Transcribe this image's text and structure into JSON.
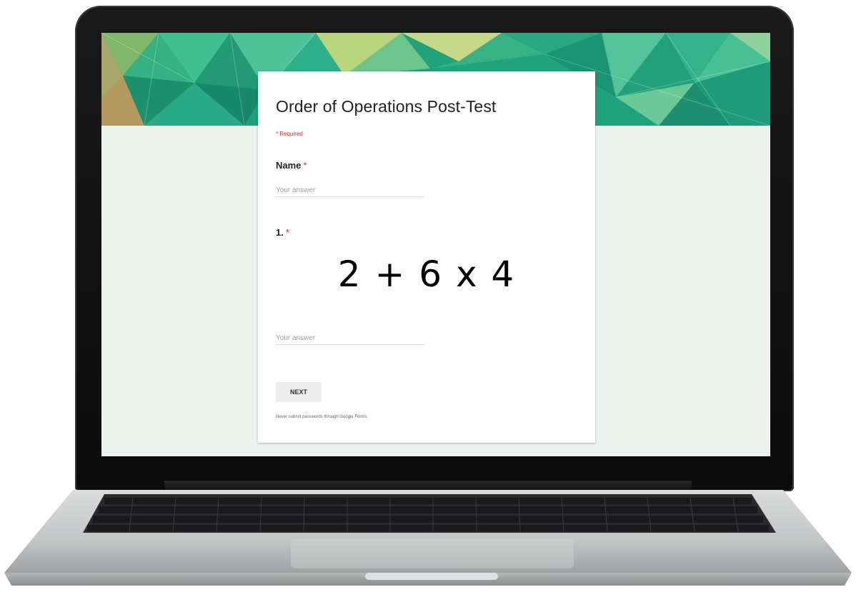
{
  "form": {
    "title": "Order of Operations Post-Test",
    "required_note": "* Required",
    "questions": [
      {
        "label": "Name",
        "required_mark": "*",
        "placeholder": "Your answer"
      },
      {
        "label": "1.",
        "required_mark": "*",
        "image_text": "2 + 6 x 4",
        "placeholder": "Your answer"
      }
    ],
    "next_label": "NEXT",
    "footer_note": "Never submit passwords through Google Forms."
  },
  "colors": {
    "banner_primary": "#1fa37a",
    "page_background": "#edf2ee",
    "required_red": "#d93025"
  },
  "icons": [
    "laptop-frame"
  ]
}
